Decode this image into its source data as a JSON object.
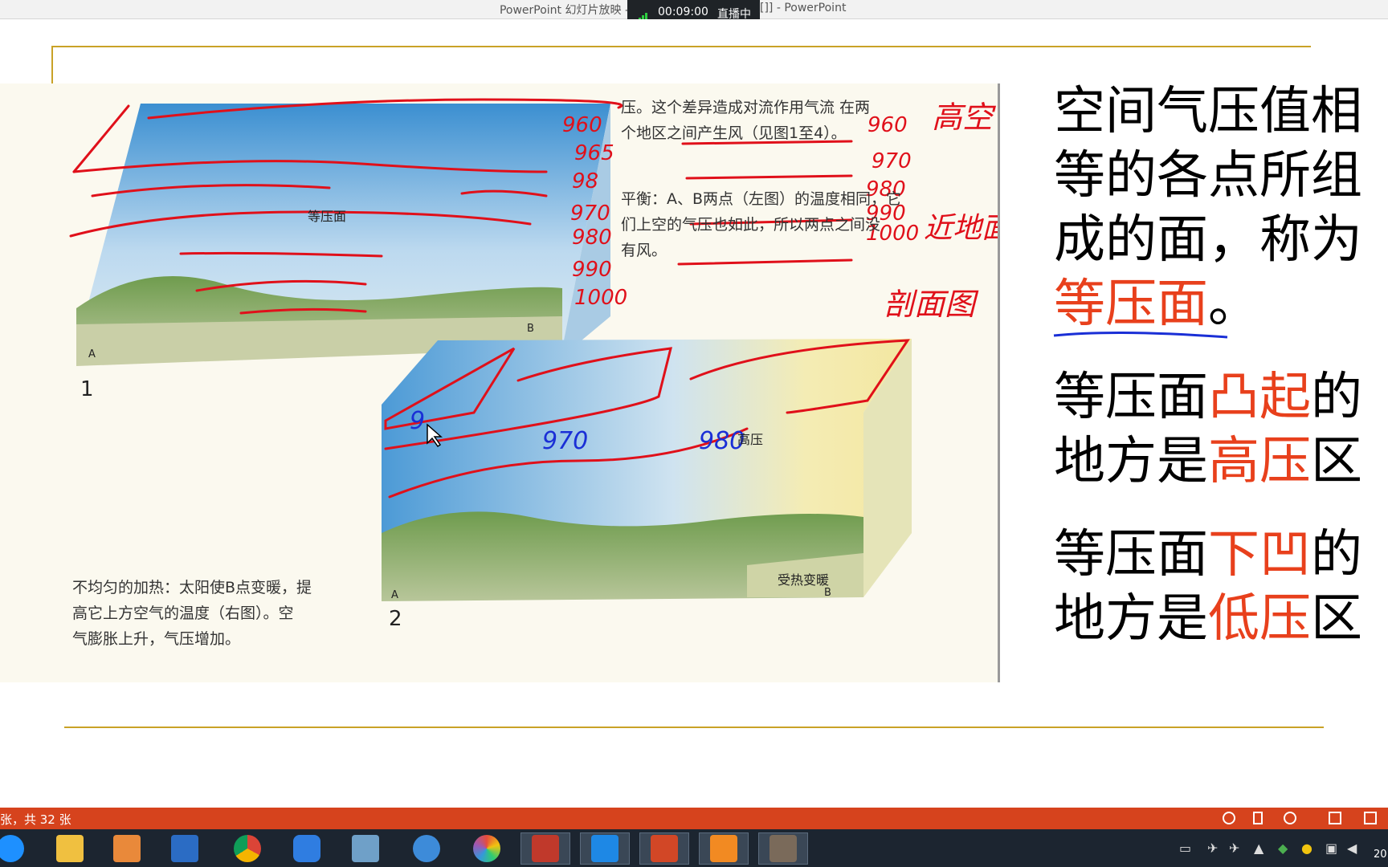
{
  "window": {
    "title_left": "PowerPoint 幻灯片放映 -",
    "title_right": "[]] - PowerPoint"
  },
  "live": {
    "timer": "00:09:00",
    "status": "直播中"
  },
  "textbook": {
    "para_top": [
      "压。这个差异造成对流作用气流 在两",
      "个地区之间产生风（见图1至4）。"
    ],
    "para_balance": [
      "平衡：A、B两点（左图）的温度相同，它",
      "们上空的气压也如此，所以两点之间没",
      "有风。"
    ],
    "para_heating": [
      "不均匀的加热：太阳使B点变暖，提",
      "高它上方空气的温度（右图）。空",
      "气膨胀上升，气压增加。"
    ],
    "label_isobaric": "等压面",
    "label_high": "高压",
    "label_warm": "受热变暖",
    "label_a1": "A",
    "label_b1": "B",
    "label_a2": "A",
    "label_b2": "B",
    "fig1": "1",
    "fig2": "2"
  },
  "annotations": {
    "red_left": [
      "960",
      "965",
      "98",
      "970",
      "980",
      "990",
      "1000"
    ],
    "red_right": [
      "960",
      "970",
      "980",
      "990",
      "1000"
    ],
    "red_words": [
      "高空",
      "近地面",
      "剖面图"
    ],
    "blue_values": [
      "9",
      "970",
      "980"
    ]
  },
  "notes": {
    "b1_pre": "空间气压值相等的各点所组成的面，称为",
    "b1_red": "等压面",
    "b1_post": "。",
    "b2_pre": "等压面",
    "b2_red1": "凸起",
    "b2_mid": "的地方是",
    "b2_red2": "高压",
    "b2_post": "区",
    "b3_pre": "等压面",
    "b3_red1": "下凹",
    "b3_mid": "的地方是",
    "b3_red2": "低压",
    "b3_post": "区"
  },
  "statusbar": {
    "slide_count": "张，共 32 张"
  },
  "taskbar": {
    "apps": [
      "ie-icon",
      "file-explorer-icon",
      "media-player-icon",
      "save-icon",
      "chrome-icon",
      "pen-note-icon",
      "photo-viewer-icon",
      "weibo-icon",
      "color-app-icon",
      "recorder-icon",
      "feishu-icon",
      "powerpoint-icon",
      "slideshow-icon",
      "screen-draw-icon"
    ],
    "clock": "20"
  },
  "colors": {
    "accent_red": "#e8401c",
    "gold": "#c9a227",
    "status_bar": "#d6431d",
    "taskbar": "#1c2530",
    "ink_red": "#e0101a",
    "ink_blue": "#1a2fd6"
  }
}
